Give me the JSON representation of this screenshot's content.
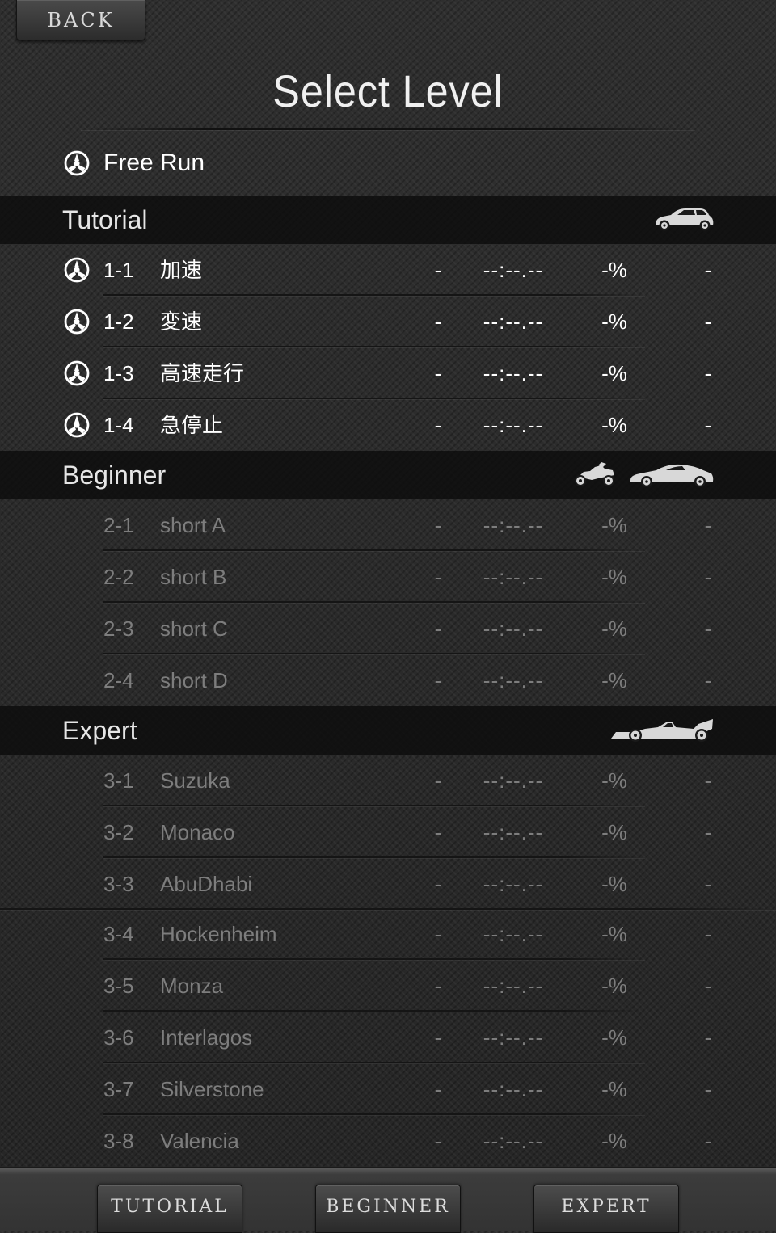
{
  "header": {
    "back_label": "BACK",
    "title": "Select Level"
  },
  "free_run": {
    "label": "Free Run"
  },
  "sections": [
    {
      "label": "Tutorial",
      "vehicle_icons": [
        "hatchback-car-icon"
      ],
      "levels": [
        {
          "num": "1-1",
          "name": "加速",
          "grade": "-",
          "time": "--:--.--",
          "percent": "-%",
          "rank": "-",
          "locked": false
        },
        {
          "num": "1-2",
          "name": "変速",
          "grade": "-",
          "time": "--:--.--",
          "percent": "-%",
          "rank": "-",
          "locked": false
        },
        {
          "num": "1-3",
          "name": "高速走行",
          "grade": "-",
          "time": "--:--.--",
          "percent": "-%",
          "rank": "-",
          "locked": false
        },
        {
          "num": "1-4",
          "name": "急停止",
          "grade": "-",
          "time": "--:--.--",
          "percent": "-%",
          "rank": "-",
          "locked": false
        }
      ]
    },
    {
      "label": "Beginner",
      "vehicle_icons": [
        "motorcycle-icon",
        "sports-car-icon"
      ],
      "levels": [
        {
          "num": "2-1",
          "name": "short A",
          "grade": "-",
          "time": "--:--.--",
          "percent": "-%",
          "rank": "-",
          "locked": true
        },
        {
          "num": "2-2",
          "name": "short B",
          "grade": "-",
          "time": "--:--.--",
          "percent": "-%",
          "rank": "-",
          "locked": true
        },
        {
          "num": "2-3",
          "name": "short C",
          "grade": "-",
          "time": "--:--.--",
          "percent": "-%",
          "rank": "-",
          "locked": true
        },
        {
          "num": "2-4",
          "name": "short D",
          "grade": "-",
          "time": "--:--.--",
          "percent": "-%",
          "rank": "-",
          "locked": true
        }
      ]
    },
    {
      "label": "Expert",
      "vehicle_icons": [
        "formula-car-icon"
      ],
      "levels": [
        {
          "num": "3-1",
          "name": "Suzuka",
          "grade": "-",
          "time": "--:--.--",
          "percent": "-%",
          "rank": "-",
          "locked": true
        },
        {
          "num": "3-2",
          "name": "Monaco",
          "grade": "-",
          "time": "--:--.--",
          "percent": "-%",
          "rank": "-",
          "locked": true
        },
        {
          "num": "3-3",
          "name": "AbuDhabi",
          "grade": "-",
          "time": "--:--.--",
          "percent": "-%",
          "rank": "-",
          "locked": true
        },
        {
          "num": "3-4",
          "name": "Hockenheim",
          "grade": "-",
          "time": "--:--.--",
          "percent": "-%",
          "rank": "-",
          "locked": true
        },
        {
          "num": "3-5",
          "name": "Monza",
          "grade": "-",
          "time": "--:--.--",
          "percent": "-%",
          "rank": "-",
          "locked": true
        },
        {
          "num": "3-6",
          "name": "Interlagos",
          "grade": "-",
          "time": "--:--.--",
          "percent": "-%",
          "rank": "-",
          "locked": true
        },
        {
          "num": "3-7",
          "name": "Silverstone",
          "grade": "-",
          "time": "--:--.--",
          "percent": "-%",
          "rank": "-",
          "locked": true
        },
        {
          "num": "3-8",
          "name": "Valencia",
          "grade": "-",
          "time": "--:--.--",
          "percent": "-%",
          "rank": "-",
          "locked": true
        }
      ]
    }
  ],
  "bottom_nav": {
    "tutorial_label": "TUTORIAL",
    "beginner_label": "BEGINNER",
    "expert_label": "EXPERT"
  },
  "colors": {
    "active_text": "#ffffff",
    "locked_text": "#7d7d7d",
    "section_band": "#0c0c0c"
  }
}
